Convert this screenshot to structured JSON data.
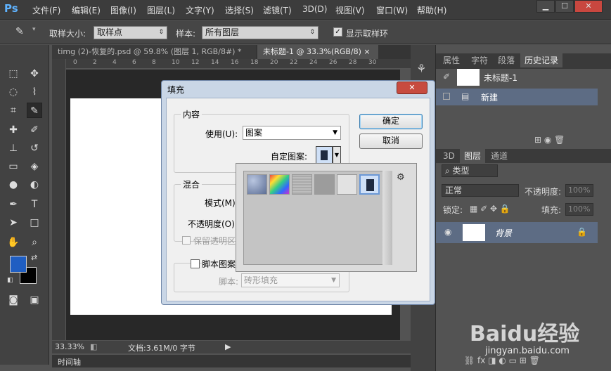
{
  "app": {
    "logo": "Ps"
  },
  "menu": [
    "文件(F)",
    "编辑(E)",
    "图像(I)",
    "图层(L)",
    "文字(Y)",
    "选择(S)",
    "滤镜(T)",
    "3D(D)",
    "视图(V)",
    "窗口(W)",
    "帮助(H)"
  ],
  "window_controls": {
    "minimize": "▁",
    "maximize": "☐",
    "close": "✕"
  },
  "options": {
    "sample_size_label": "取样大小:",
    "sample_size_value": "取样点",
    "sample_label": "样本:",
    "sample_value": "所有图层",
    "show_ring_label": "显示取样环"
  },
  "tabs": [
    {
      "label": "timg (2)-恢复的.psd @ 59.8% (图层 1, RGB/8#) *",
      "close": "×"
    },
    {
      "label": "未标题-1 @ 33.3%(RGB/8)",
      "close": "×"
    }
  ],
  "ruler_ticks": [
    "0",
    "2",
    "4",
    "6",
    "8",
    "10",
    "12",
    "14",
    "16",
    "18",
    "20",
    "22",
    "24",
    "26",
    "28",
    "30"
  ],
  "status": {
    "zoom": "33.33%",
    "doc": "文档:3.61M/0 字节",
    "timeline": "时间轴"
  },
  "panels": {
    "top_tabs": [
      "属性",
      "字符",
      "段落",
      "历史记录"
    ],
    "history": {
      "snapshot_label": "未标题-1",
      "item_label": "新建"
    },
    "mid_tabs": [
      "3D",
      "图层",
      "通道"
    ],
    "layers": {
      "kind_label": "类型",
      "blend_mode": "正常",
      "opacity_label": "不透明度:",
      "opacity_value": "100%",
      "lock_label": "锁定:",
      "fill_label": "填充:",
      "fill_value": "100%",
      "layer_name": "背景"
    }
  },
  "dialog": {
    "title": "填充",
    "close": "✕",
    "content_group": "内容",
    "use_label": "使用(U):",
    "use_value": "图案",
    "custom_pattern_label": "自定图案:",
    "blend_group": "混合",
    "mode_label": "模式(M):",
    "opacity_label": "不透明度(O):",
    "preserve_label": "保留透明区域",
    "script_label": "脚本图案",
    "script_field_label": "脚本:",
    "script_value": "砖形填充",
    "ok": "确定",
    "cancel": "取消"
  },
  "pattern_picker": {
    "swatch_count": 6,
    "selected_index": 5,
    "gear": "⚙"
  },
  "watermark": {
    "brand": "Baidu经验",
    "url": "jingyan.baidu.com"
  },
  "colors": {
    "foreground": "#1f5ec2",
    "background": "#000000",
    "accent": "#5fb3ff"
  }
}
